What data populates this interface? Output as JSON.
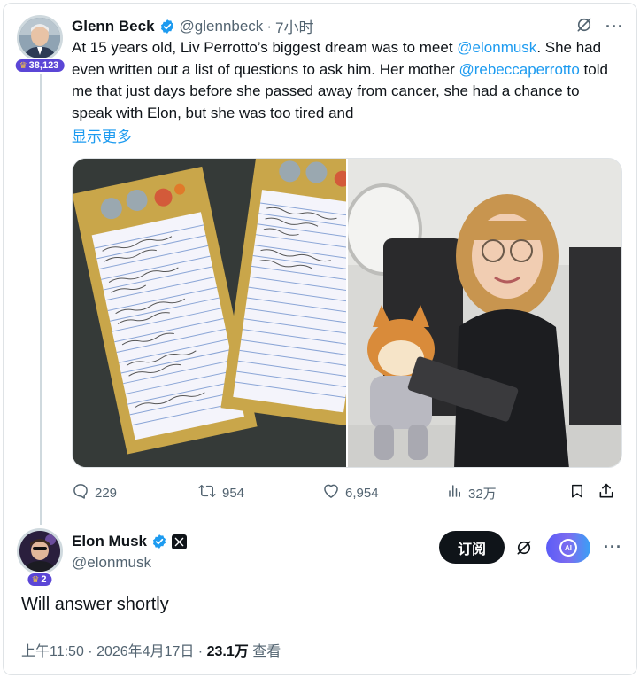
{
  "original_tweet": {
    "author_name": "Glenn Beck",
    "author_handle": "@glennbeck",
    "separator": "·",
    "time": "7小时",
    "badge_count": "38,123",
    "text_parts": [
      {
        "text": "At 15 years old, Liv Perrotto’s biggest dream was to meet ",
        "type": "plain"
      },
      {
        "text": "@elonmusk",
        "type": "mention"
      },
      {
        "text": ". She had even written out a list of questions to ask him. Her mother ",
        "type": "plain"
      },
      {
        "text": "@rebeccaperrotto",
        "type": "mention"
      },
      {
        "text": " told me that just days before she passed away from cancer, she had a chance to speak with Elon, but she was too tired and",
        "type": "plain"
      }
    ],
    "show_more": "显示更多",
    "stats": {
      "replies": "229",
      "reposts": "954",
      "likes": "6,954",
      "views": "32万"
    },
    "colors": {
      "mention": "#1d9bf0",
      "verified": "#1d9bf0"
    }
  },
  "reply_tweet": {
    "author_name": "Elon Musk",
    "author_handle": "@elonmusk",
    "badge_count": "2",
    "subscribe_label": "订阅",
    "ai_label": "AI",
    "text": "Will answer shortly",
    "timestamp": "上午11:50 · 2026年4月17日 · ",
    "view_count": "23.1万",
    "view_label": " 查看"
  },
  "icons": [
    "verified-icon",
    "grok-icon",
    "more-icon",
    "reply-icon",
    "repost-icon",
    "like-icon",
    "views-icon",
    "bookmark-icon",
    "share-icon",
    "x-logo-icon",
    "trophy-icon"
  ]
}
